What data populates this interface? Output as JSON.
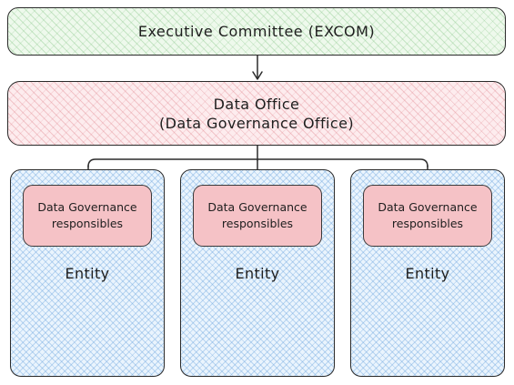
{
  "excom": {
    "label": "Executive Committee (EXCOM)"
  },
  "data_office": {
    "line1": "Data Office",
    "line2": "(Data Governance Office)"
  },
  "entities": [
    {
      "label": "Entity",
      "responsibles": {
        "line1": "Data Governance",
        "line2": "responsibles"
      }
    },
    {
      "label": "Entity",
      "responsibles": {
        "line1": "Data Governance",
        "line2": "responsibles"
      }
    },
    {
      "label": "Entity",
      "responsibles": {
        "line1": "Data Governance",
        "line2": "responsibles"
      }
    }
  ]
}
